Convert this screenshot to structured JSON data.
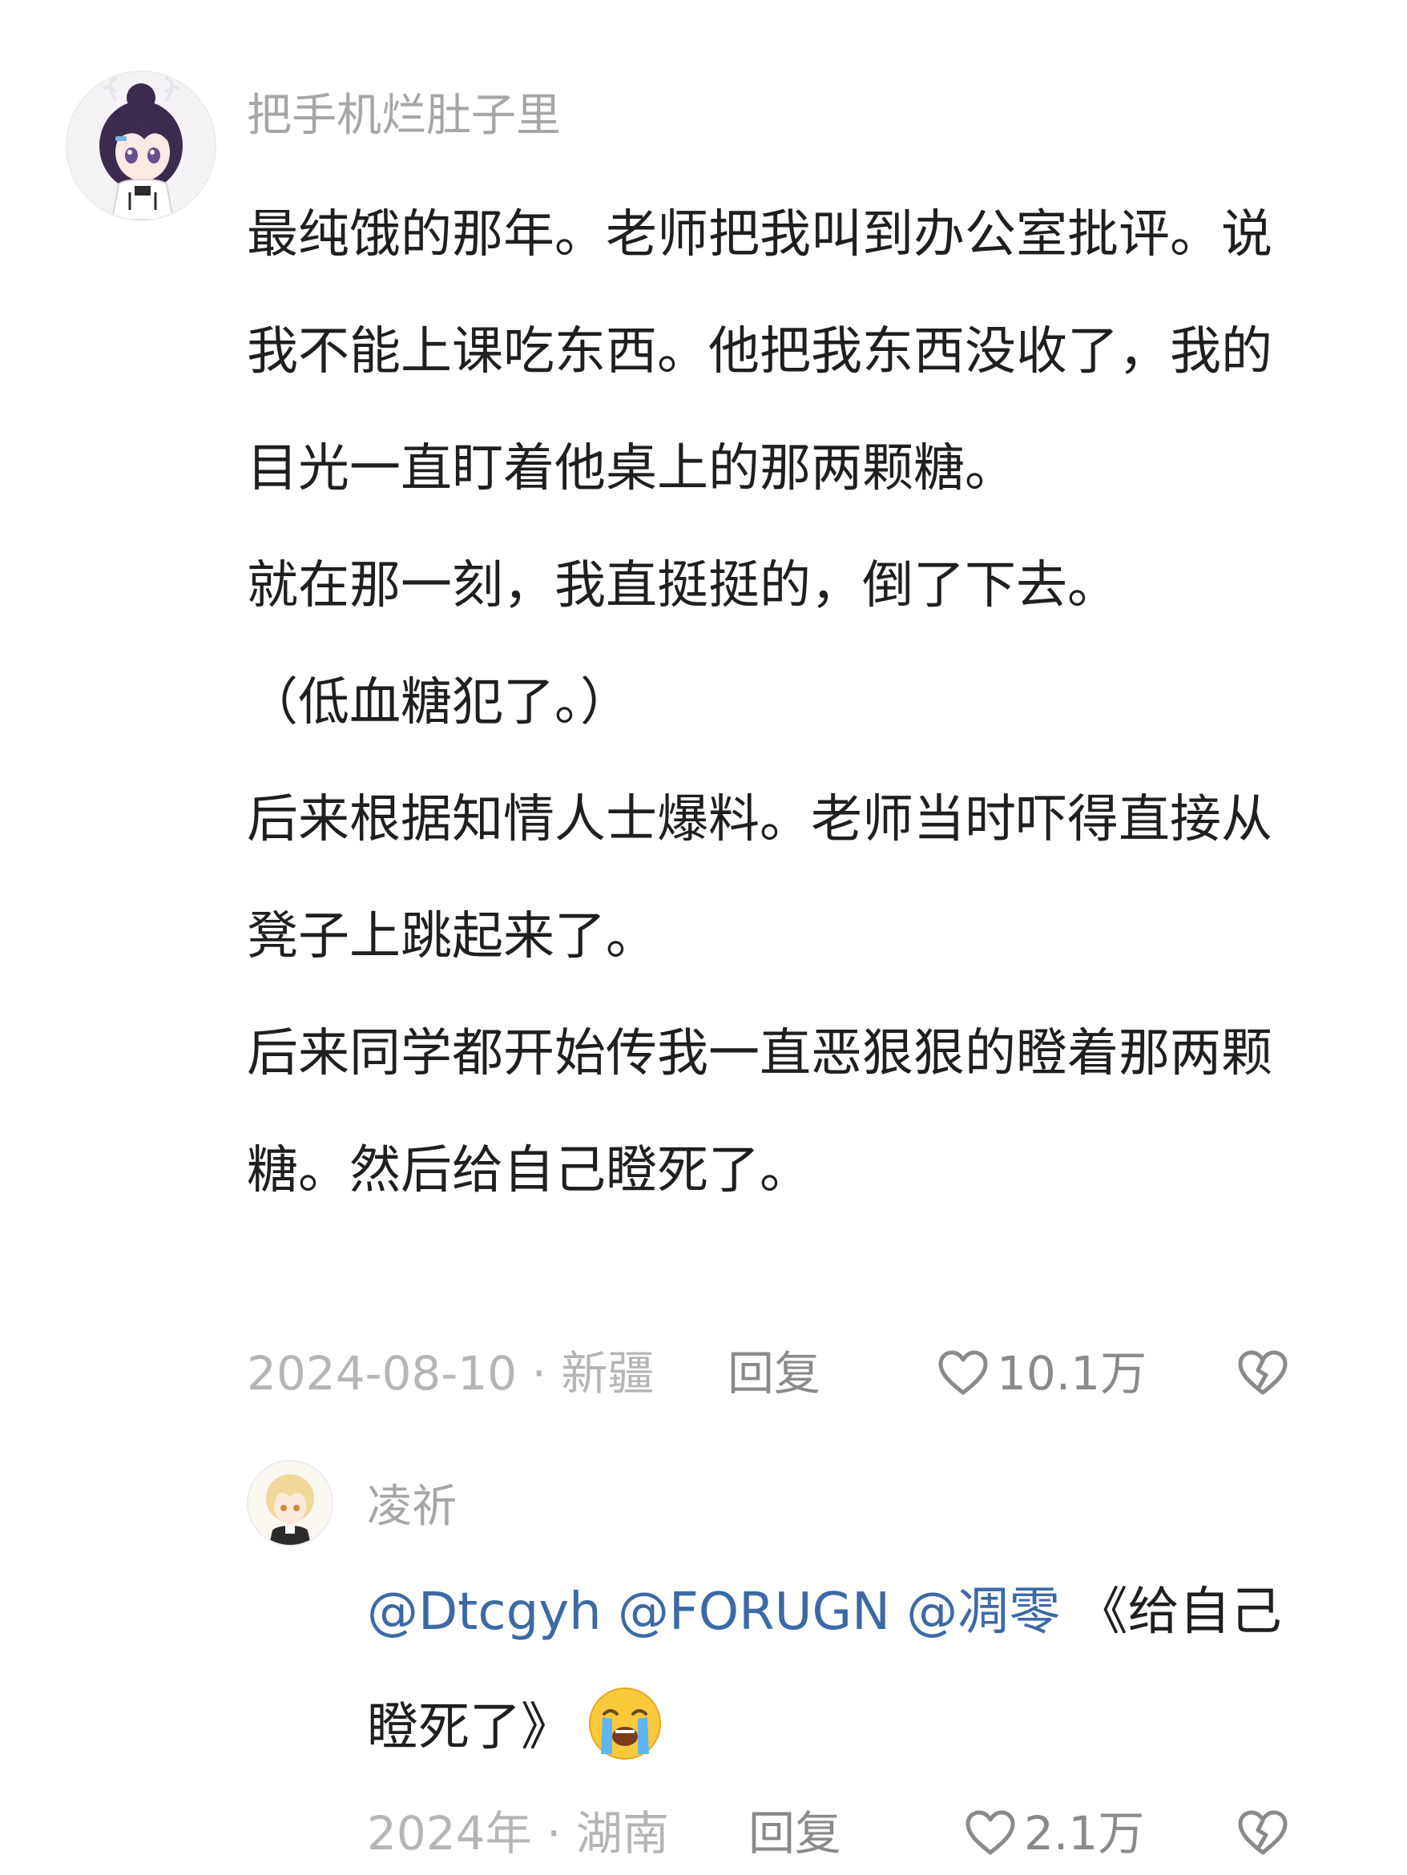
{
  "main_comment": {
    "username": "把手机烂肚子里",
    "paragraphs": [
      "最纯饿的那年。老师把我叫到办公室批评。说我不能上课吃东西。他把我东西没收了，我的目光一直盯着他桌上的那两颗糖。",
      "就在那一刻，我直挺挺的，倒了下去。",
      "（低血糖犯了。）",
      "后来根据知情人士爆料。老师当时吓得直接从凳子上跳起来了。",
      "后来同学都开始传我一直恶狠狠的瞪着那两颗糖。然后给自己瞪死了。"
    ],
    "date_location": "2024-08-10 · 新疆",
    "reply_label": "回复",
    "like_count": "10.1万",
    "like_icon": "heart-outline-icon",
    "dislike_icon": "broken-heart-icon"
  },
  "reply_comment": {
    "username": "凌祈",
    "mentions": [
      "@Dtcgyh",
      "@FORUGN",
      "@凋零"
    ],
    "text": "《给自己瞪死了》",
    "emoji": "loudly-crying-face",
    "date_location": "2024年 · 湖南",
    "reply_label": "回复",
    "like_count": "2.1万",
    "like_icon": "heart-outline-icon",
    "dislike_icon": "broken-heart-icon"
  },
  "colors": {
    "mention": "#3b6aa5",
    "meta_text": "#b5b5b5",
    "username": "#a6a6a6",
    "body_text": "#1f1f1f"
  }
}
